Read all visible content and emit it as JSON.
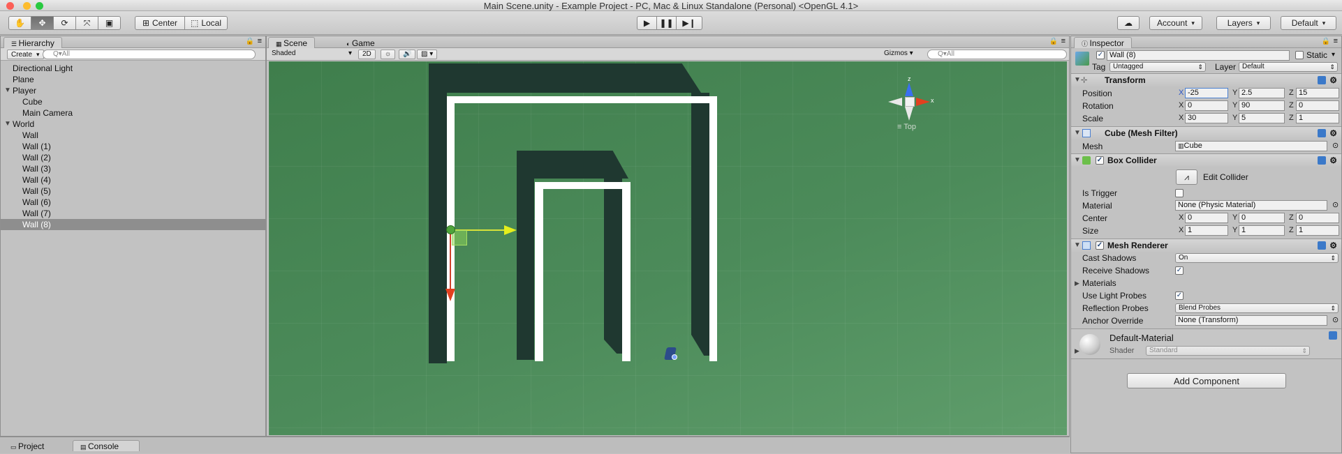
{
  "window": {
    "title": "Main Scene.unity - Example Project - PC, Mac & Linux Standalone (Personal) <OpenGL 4.1>"
  },
  "toolbar": {
    "tools": [
      "hand-tool",
      "move-tool",
      "rotate-tool",
      "scale-tool",
      "rect-tool"
    ],
    "pivot_label": "Center",
    "space_label": "Local",
    "account_label": "Account",
    "layers_label": "Layers",
    "layout_label": "Default"
  },
  "hierarchy": {
    "tab": "Hierarchy",
    "create_label": "Create",
    "search_placeholder": "Q▾All",
    "items": [
      {
        "label": "Directional Light"
      },
      {
        "label": "Plane"
      },
      {
        "label": "Player"
      },
      {
        "label": "Cube"
      },
      {
        "label": "Main Camera"
      },
      {
        "label": "World"
      },
      {
        "label": "Wall"
      },
      {
        "label": "Wall (1)"
      },
      {
        "label": "Wall (2)"
      },
      {
        "label": "Wall (3)"
      },
      {
        "label": "Wall (4)"
      },
      {
        "label": "Wall (5)"
      },
      {
        "label": "Wall (6)"
      },
      {
        "label": "Wall (7)"
      },
      {
        "label": "Wall (8)"
      }
    ]
  },
  "scene": {
    "tab_scene": "Scene",
    "tab_game": "Game",
    "shading": "Shaded",
    "mode_2d": "2D",
    "gizmos_label": "Gizmos",
    "search_placeholder": "Q▾All",
    "view_label": "Top",
    "gizmo_axes": {
      "z": "z",
      "x": "x"
    },
    "bg_color": "#4c8a58"
  },
  "bottom": {
    "tab_project": "Project",
    "tab_console": "Console"
  },
  "inspector": {
    "tab": "Inspector",
    "object_name": "Wall (8)",
    "static_label": "Static",
    "tag_label": "Tag",
    "tag_value": "Untagged",
    "layer_label": "Layer",
    "layer_value": "Default",
    "transform": {
      "title": "Transform",
      "position_label": "Position",
      "rotation_label": "Rotation",
      "scale_label": "Scale",
      "position": {
        "x": "-25",
        "y": "2.5",
        "z": "15"
      },
      "rotation": {
        "x": "0",
        "y": "90",
        "z": "0"
      },
      "scale": {
        "x": "30",
        "y": "5",
        "z": "1"
      }
    },
    "mesh_filter": {
      "title": "Cube (Mesh Filter)",
      "mesh_label": "Mesh",
      "mesh_value": "Cube"
    },
    "box_collider": {
      "title": "Box Collider",
      "edit_label": "Edit Collider",
      "is_trigger_label": "Is Trigger",
      "material_label": "Material",
      "material_value": "None (Physic Material)",
      "center_label": "Center",
      "size_label": "Size",
      "center": {
        "x": "0",
        "y": "0",
        "z": "0"
      },
      "size": {
        "x": "1",
        "y": "1",
        "z": "1"
      }
    },
    "mesh_renderer": {
      "title": "Mesh Renderer",
      "cast_shadows_label": "Cast Shadows",
      "cast_shadows_value": "On",
      "receive_shadows_label": "Receive Shadows",
      "materials_label": "Materials",
      "light_probes_label": "Use Light Probes",
      "reflection_probes_label": "Reflection Probes",
      "reflection_probes_value": "Blend Probes",
      "anchor_label": "Anchor Override",
      "anchor_value": "None (Transform)"
    },
    "material": {
      "name": "Default-Material",
      "shader_label": "Shader",
      "shader_value": "Standard"
    },
    "axis_labels": {
      "x": "X",
      "y": "Y",
      "z": "Z"
    },
    "add_component_label": "Add Component"
  }
}
